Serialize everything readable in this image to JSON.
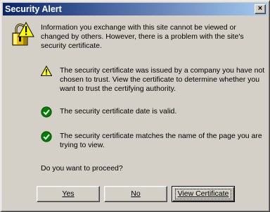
{
  "window": {
    "title": "Security Alert",
    "close_glyph": "×"
  },
  "intro": {
    "icon": "padlock-warning-icon",
    "text": "Information you exchange with this site cannot be viewed or changed by others. However, there is a problem with the site's security certificate."
  },
  "checks": [
    {
      "status": "warning",
      "icon": "warning-triangle-icon",
      "text": "The security certificate was issued by a company you have not chosen to trust. View the certificate to determine whether you want to trust the certifying authority."
    },
    {
      "status": "ok",
      "icon": "green-check-icon",
      "text": "The security certificate date is valid."
    },
    {
      "status": "ok",
      "icon": "green-check-icon",
      "text": "The security certificate matches the name of the page you are trying to view."
    }
  ],
  "question": "Do you want to proceed?",
  "buttons": {
    "yes": "Yes",
    "no": "No",
    "view_certificate": "View Certificate"
  },
  "colors": {
    "title_bar_start": "#0a246a",
    "title_bar_end": "#a6caf0",
    "dialog_face": "#d4d0c8",
    "warning_yellow": "#ffff00",
    "check_green": "#008000"
  }
}
